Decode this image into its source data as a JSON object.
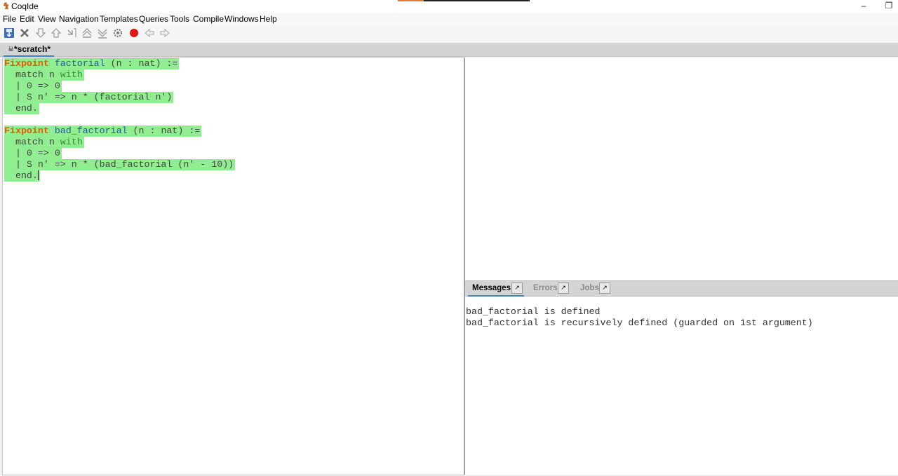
{
  "window": {
    "title": "CoqIde",
    "minimize_glyph": "–",
    "restore_glyph": "❐"
  },
  "menu": [
    "File",
    "Edit",
    "View",
    "Navigation",
    "Templates",
    "Queries",
    "Tools",
    "Compile",
    "Windows",
    "Help"
  ],
  "toolbar": {
    "icons": [
      "save-icon",
      "close-icon",
      "forward-one-icon",
      "backward-one-icon",
      "go-to-cursor-icon",
      "restart-icon",
      "go-to-end-icon",
      "compile-icon",
      "interrupt-icon",
      "previous-occurrence-icon",
      "next-occurrence-icon"
    ]
  },
  "tab": {
    "label": "*scratch*"
  },
  "editor": {
    "lines": [
      [
        "Fixpoint",
        " factorial",
        " (n : nat) :="
      ],
      [
        "",
        "",
        "  match n ",
        "with"
      ],
      [
        "",
        "",
        "  | 0 => 0"
      ],
      [
        "",
        "",
        "  | S n' => n * (factorial n')"
      ],
      [
        "",
        "",
        "  end."
      ],
      [
        "Fixpoint",
        " bad_factorial",
        " (n : nat) :="
      ],
      [
        "",
        "",
        "  match n ",
        "with"
      ],
      [
        "",
        "",
        "  | 0 => 0"
      ],
      [
        "",
        "",
        "  | S n' => n * (bad_factorial (n' - 10))"
      ],
      [
        "",
        "",
        "  end."
      ]
    ],
    "highlight_color": "#90ee90",
    "keyword_color": "#e55a00",
    "identifier_color": "#2257b0"
  },
  "message_tabs": {
    "messages": "Messages",
    "errors": "Errors",
    "jobs": "Jobs",
    "detach_glyph": "↗"
  },
  "messages": [
    "bad_factorial is defined",
    "bad_factorial is recursively defined (guarded on 1st argument)"
  ]
}
